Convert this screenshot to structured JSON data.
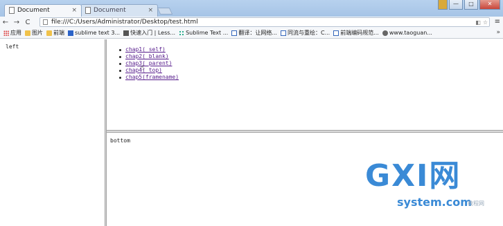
{
  "tabs": [
    {
      "title": "Document",
      "close": "×"
    },
    {
      "title": "Document",
      "close": "×"
    }
  ],
  "window_buttons": {
    "minimize": "—",
    "maximize": "□",
    "close": "✕"
  },
  "nav": {
    "back": "←",
    "forward": "→",
    "reload": "C"
  },
  "address": {
    "url": "file:///C:/Users/Administrator/Desktop/test.html"
  },
  "bookmarks": [
    {
      "label": "应用",
      "icon": "apps-grid-icon"
    },
    {
      "label": "图片",
      "icon": "folder-icon"
    },
    {
      "label": "前端",
      "icon": "folder-icon"
    },
    {
      "label": "sublime text 3...",
      "icon": "bookmark-icon"
    },
    {
      "label": "快速入门 | Less...",
      "icon": "mail-icon"
    },
    {
      "label": "Sublime Text ...",
      "icon": "dots-icon"
    },
    {
      "label": "翻译：让网络...",
      "icon": "doc-icon"
    },
    {
      "label": "同流与重绘：C...",
      "icon": "doc-icon"
    },
    {
      "label": "前端编码规范...",
      "icon": "doc-icon"
    },
    {
      "label": "www.taoguan...",
      "icon": "globe-icon"
    }
  ],
  "bookmarks_more": "»",
  "frames": {
    "left_text": "left",
    "bottom_text": "bottom",
    "links": [
      "chap1(_self)",
      "chap2(_blank)",
      "chap3(_parent)",
      "chap4(_top)",
      "chap5(framename)"
    ]
  },
  "watermark": {
    "main": "GXI网",
    "sub": "system.com",
    "tag": "教程网"
  }
}
